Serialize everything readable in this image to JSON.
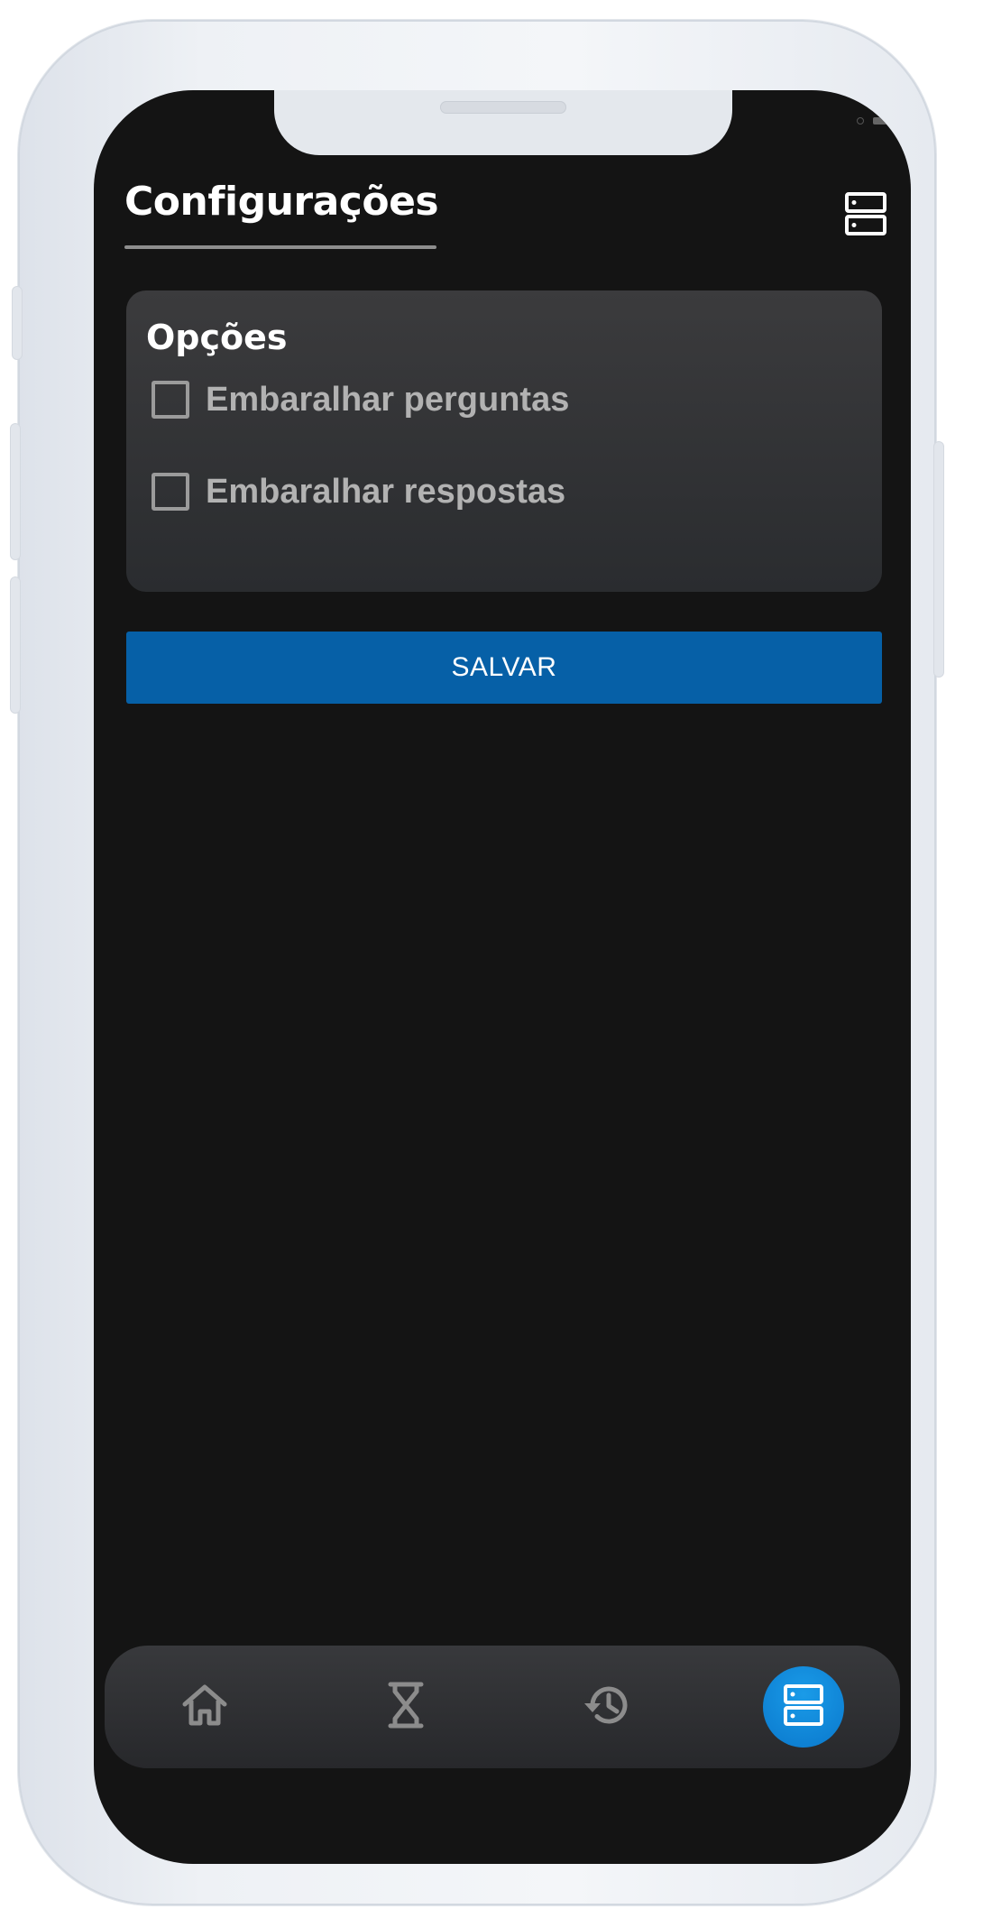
{
  "header": {
    "title": "Configurações",
    "menu_icon": "server-stack-icon"
  },
  "options_card": {
    "title": "Opções",
    "options": [
      {
        "label": "Embaralhar perguntas",
        "checked": false
      },
      {
        "label": "Embaralhar respostas",
        "checked": false
      }
    ]
  },
  "actions": {
    "save_label": "SALVAR"
  },
  "bottom_nav": {
    "items": [
      {
        "icon": "home-icon",
        "active": false
      },
      {
        "icon": "hourglass-icon",
        "active": false
      },
      {
        "icon": "history-icon",
        "active": false
      },
      {
        "icon": "server-stack-icon",
        "active": true
      }
    ]
  },
  "colors": {
    "background": "#141414",
    "card": "#333436",
    "accent": "#0660a7",
    "active_nav": "#1a8fe0",
    "text_primary": "#ffffff",
    "text_secondary": "#b2b2b2"
  }
}
